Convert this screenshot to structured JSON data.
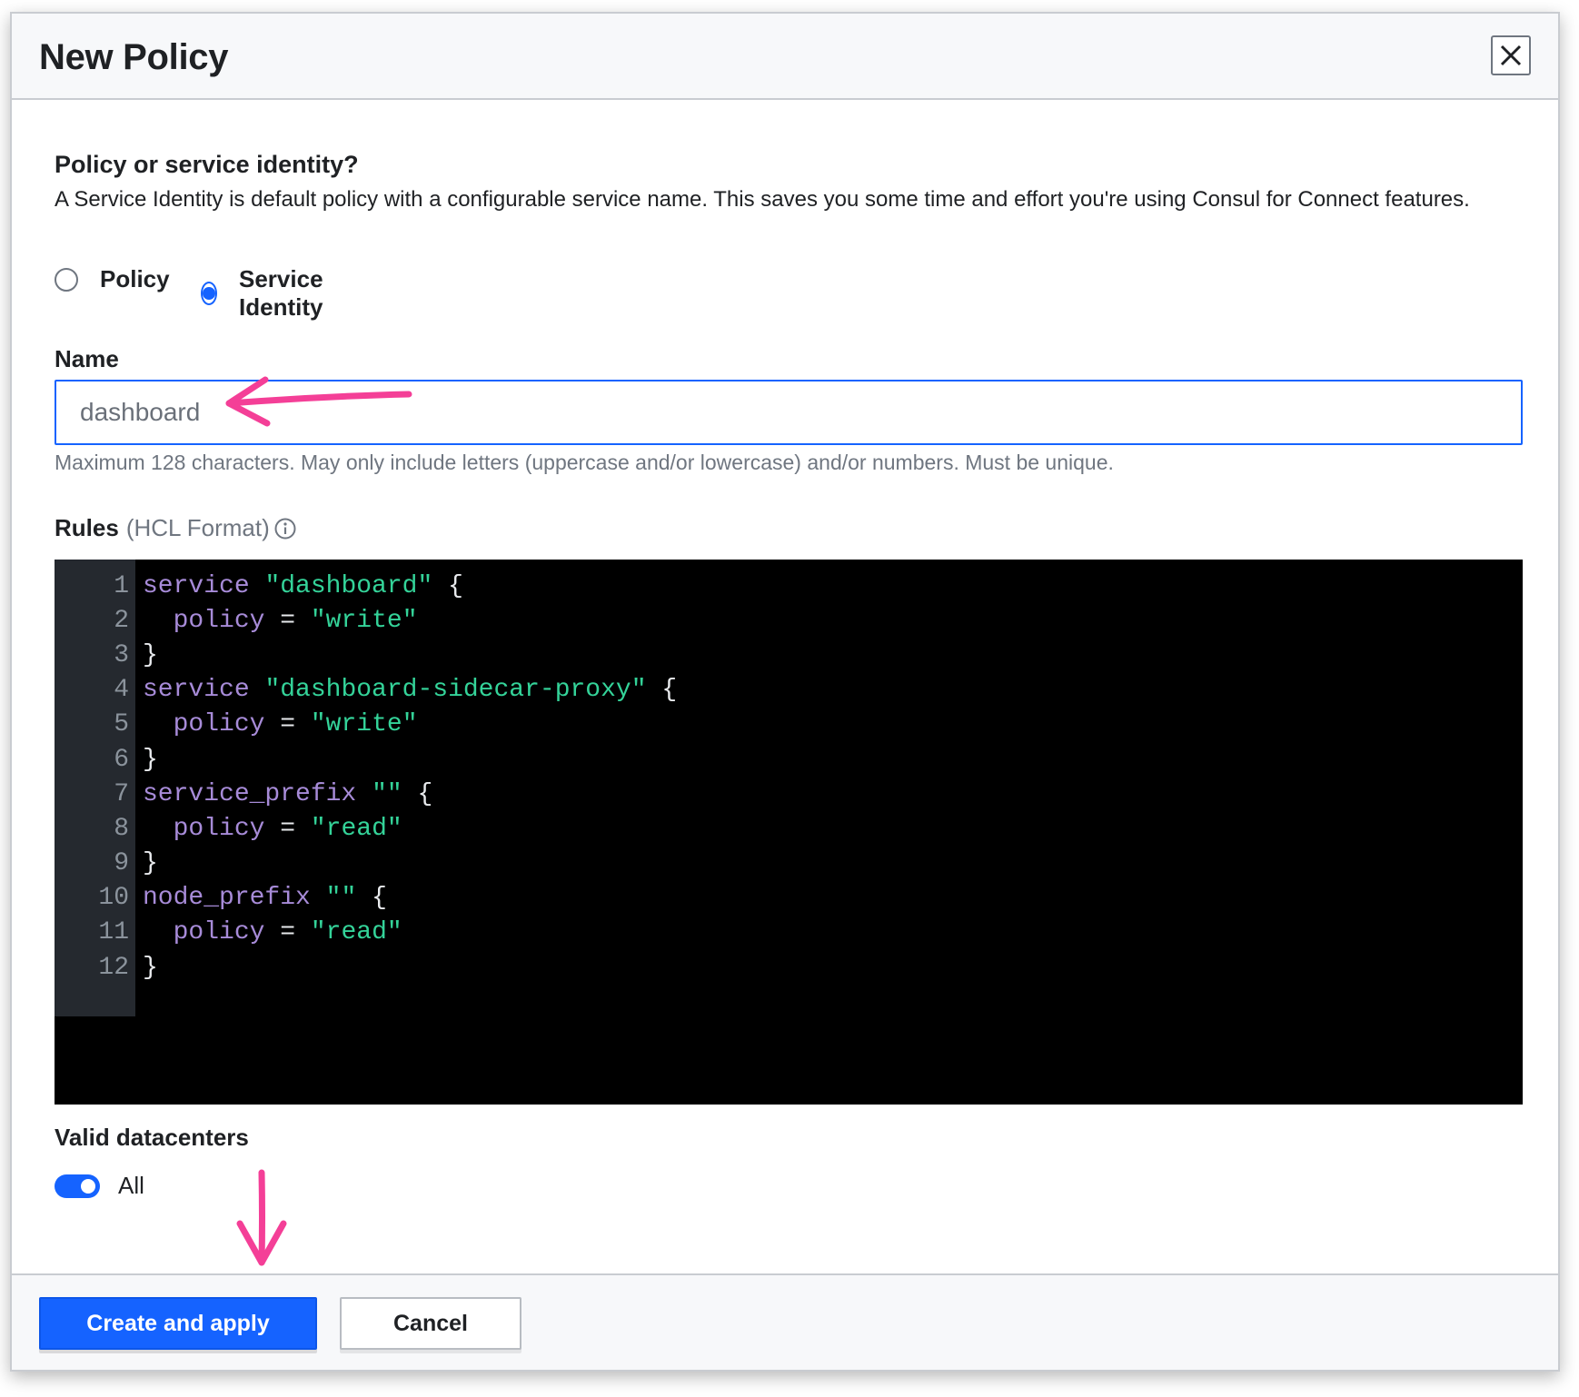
{
  "modal": {
    "title": "New Policy",
    "close_icon": "close-icon"
  },
  "policy_type": {
    "heading": "Policy or service identity?",
    "description": "A Service Identity is default policy with a configurable service name. This saves you some time and effort you're using Consul for Connect features.",
    "options": [
      {
        "label": "Policy",
        "checked": false
      },
      {
        "label": "Service Identity",
        "checked": true
      }
    ]
  },
  "name_field": {
    "label": "Name",
    "value": "dashboard",
    "help": "Maximum 128 characters. May only include letters (uppercase and/or lowercase) and/or numbers. Must be unique."
  },
  "rules": {
    "label": "Rules",
    "format": "(HCL Format)",
    "info_icon": "info-icon",
    "lines": [
      {
        "num": "1",
        "text": "service \"dashboard\" {"
      },
      {
        "num": "2",
        "text": "  policy = \"write\""
      },
      {
        "num": "3",
        "text": "}"
      },
      {
        "num": "4",
        "text": "service \"dashboard-sidecar-proxy\" {"
      },
      {
        "num": "5",
        "text": "  policy = \"write\""
      },
      {
        "num": "6",
        "text": "}"
      },
      {
        "num": "7",
        "text": "service_prefix \"\" {"
      },
      {
        "num": "8",
        "text": "  policy = \"read\""
      },
      {
        "num": "9",
        "text": "}"
      },
      {
        "num": "10",
        "text": "node_prefix \"\" {"
      },
      {
        "num": "11",
        "text": "  policy = \"read\""
      },
      {
        "num": "12",
        "text": "}"
      }
    ]
  },
  "datacenters": {
    "label": "Valid datacenters",
    "toggle_on": true,
    "toggle_label": "All"
  },
  "footer": {
    "primary_label": "Create and apply",
    "cancel_label": "Cancel"
  },
  "colors": {
    "accent": "#1563ff",
    "annotation": "#f43f97",
    "code_keyword": "#a78bd8",
    "code_string": "#34d399"
  }
}
